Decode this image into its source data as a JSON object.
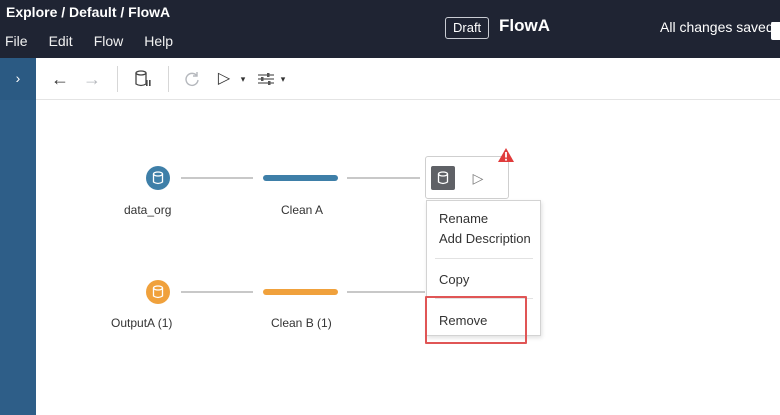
{
  "breadcrumb": {
    "items": [
      "Explore",
      "Default",
      "FlowA"
    ],
    "separator": " / "
  },
  "menu": [
    "File",
    "Edit",
    "Flow",
    "Help"
  ],
  "header": {
    "badge": "Draft",
    "title": "FlowA",
    "status": "All changes saved"
  },
  "sidebar": {
    "toggle_glyph": "›"
  },
  "toolbar": {
    "back": "←",
    "forward": "→",
    "run": "▷",
    "dropdown": "▾"
  },
  "flow": {
    "nodes": [
      {
        "label": "data_org",
        "color": "#3e7fa8"
      },
      {
        "label": "Clean A",
        "color": "#3e7fa8"
      },
      {
        "label": "OutputA (1)",
        "color": "#f0a13c"
      },
      {
        "label": "Clean B (1)",
        "color": "#f0a13c"
      }
    ]
  },
  "output_node": {
    "run_glyph": "▷"
  },
  "context_menu": {
    "items": [
      "Rename",
      "Add Description",
      "Copy",
      "Remove"
    ]
  },
  "colors": {
    "topbar": "#1f2433",
    "sidebar": "#2e5e88",
    "blue": "#3e7fa8",
    "orange": "#f0a13c",
    "warning": "#e03b3b",
    "highlight": "#e05555"
  }
}
